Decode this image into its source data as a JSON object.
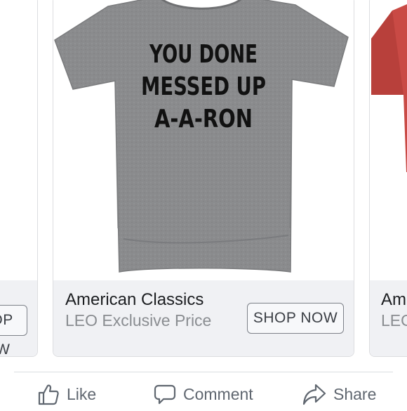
{
  "carousel": {
    "left_card": {
      "cta_label": "SHOP NOW"
    },
    "main_card": {
      "image_text_lines": [
        "YOU DONE",
        "MESSED UP",
        "A-A-RON"
      ],
      "title": "American Classics",
      "subtitle": "LEO Exclusive Price",
      "cta_label": "SHOP NOW",
      "colors": {
        "shirt": "#8a8b8d",
        "print": "#111111"
      }
    },
    "right_card": {
      "title": "American Classics",
      "subtitle": "LEO Exclusive Price",
      "colors": {
        "shirt": "#c94a45"
      }
    }
  },
  "actions": {
    "like_label": "Like",
    "comment_label": "Comment",
    "share_label": "Share",
    "icons": [
      "thumbs-up-icon",
      "comment-bubble-icon",
      "share-arrow-icon"
    ]
  }
}
